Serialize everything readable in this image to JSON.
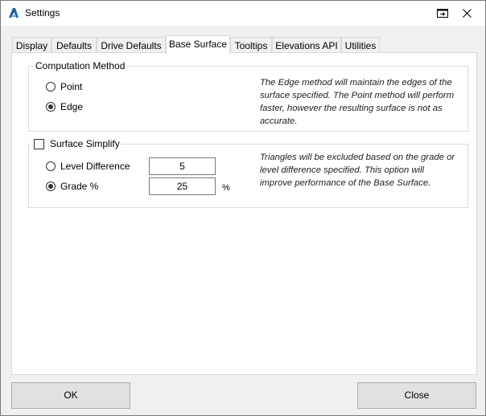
{
  "window": {
    "title": "Settings",
    "icons": {
      "app": "autodesk-a-icon",
      "pin": "window-restore-icon",
      "close": "close-icon"
    }
  },
  "tabs": [
    {
      "label": "Display"
    },
    {
      "label": "Defaults"
    },
    {
      "label": "Drive Defaults"
    },
    {
      "label": "Base Surface",
      "active": true
    },
    {
      "label": "Tooltips"
    },
    {
      "label": "Elevations API"
    },
    {
      "label": "Utilities"
    }
  ],
  "computation": {
    "title": "Computation Method",
    "options": [
      {
        "label": "Point",
        "selected": false
      },
      {
        "label": "Edge",
        "selected": true
      }
    ],
    "description": "The Edge method will maintain the edges of the surface specified. The Point method will perform faster, however the resulting surface is not as accurate."
  },
  "simplify": {
    "title": "Surface Simplify",
    "checked": false,
    "level_label": "Level Difference",
    "level_selected": false,
    "level_value": "5",
    "grade_label": "Grade %",
    "grade_selected": true,
    "grade_value": "25",
    "grade_unit": "%",
    "description": "Triangles will be excluded based on the grade or level difference specified. This option will improve performance of the Base Surface."
  },
  "buttons": {
    "ok": "OK",
    "close": "Close"
  }
}
